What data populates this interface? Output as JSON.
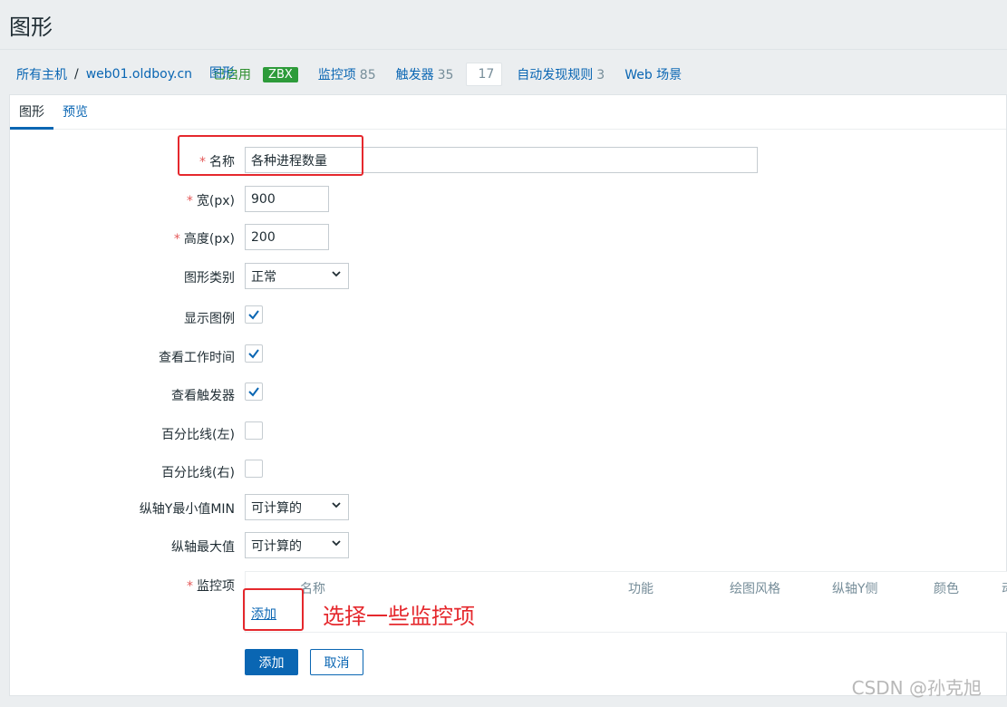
{
  "page_title": "图形",
  "breadcrumb": {
    "all_hosts": "所有主机",
    "host": "web01.oldboy.cn",
    "status": "已启用",
    "zbx": "ZBX",
    "nav": [
      {
        "label": "监控项",
        "count": "85"
      },
      {
        "label": "触发器",
        "count": "35"
      },
      {
        "label": "图形",
        "count": "17"
      },
      {
        "label": "自动发现规则",
        "count": "3"
      },
      {
        "label": "Web 场景",
        "count": ""
      }
    ]
  },
  "tabs": {
    "graph": "图形",
    "preview": "预览"
  },
  "form": {
    "name_label": "名称",
    "name_value": "各种进程数量",
    "width_label": "宽(px)",
    "width_value": "900",
    "height_label": "高度(px)",
    "height_value": "200",
    "graph_type_label": "图形类别",
    "graph_type_value": "正常",
    "show_legend_label": "显示图例",
    "show_worktime_label": "查看工作时间",
    "show_triggers_label": "查看触发器",
    "percentile_left_label": "百分比线(左)",
    "percentile_right_label": "百分比线(右)",
    "ymin_label": "纵轴Y最小值MIN",
    "ymin_value": "可计算的",
    "ymax_label": "纵轴最大值",
    "ymax_value": "可计算的",
    "items_label": "监控项",
    "items_columns": [
      "名称",
      "功能",
      "绘图风格",
      "纵轴Y侧",
      "颜色",
      "动"
    ],
    "items_add_link": "添加"
  },
  "checkboxes": {
    "show_legend": true,
    "show_worktime": true,
    "show_triggers": true,
    "percentile_left": false,
    "percentile_right": false
  },
  "buttons": {
    "add": "添加",
    "cancel": "取消"
  },
  "annotation": "选择一些监控项",
  "watermark": "CSDN @孙克旭",
  "colors": {
    "accent": "#0a66b3",
    "enabled": "#2f8f2f",
    "zbx_badge": "#2d9b3a",
    "annotation": "#e5282d"
  }
}
